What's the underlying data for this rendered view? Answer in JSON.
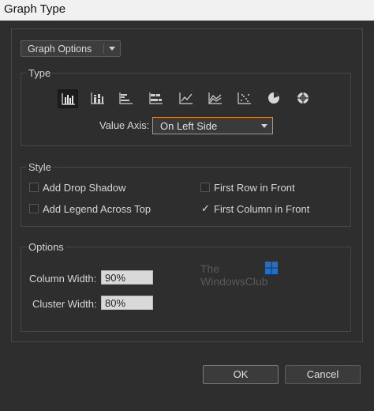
{
  "window": {
    "title": "Graph Type"
  },
  "graph_options": {
    "label": "Graph Options"
  },
  "type_group": {
    "label": "Type",
    "icons": [
      "grouped-column-graph",
      "stacked-column-graph",
      "grouped-bar-graph",
      "stacked-bar-graph",
      "line-graph",
      "area-graph",
      "scatter-graph",
      "pie-graph",
      "radar-graph"
    ],
    "selected_index": 0,
    "value_axis_label": "Value Axis:",
    "value_axis_value": "On Left Side"
  },
  "style_group": {
    "label": "Style",
    "add_drop_shadow": {
      "label": "Add Drop Shadow",
      "checked": false
    },
    "add_legend_across_top": {
      "label": "Add Legend Across Top",
      "checked": false
    },
    "first_row_in_front": {
      "label": "First Row in Front",
      "checked": false
    },
    "first_column_in_front": {
      "label": "First Column in Front",
      "checked": true,
      "mark": "✓"
    }
  },
  "options_group": {
    "label": "Options",
    "column_width_label": "Column Width:",
    "column_width_value": "90%",
    "cluster_width_label": "Cluster Width:",
    "cluster_width_value": "80%"
  },
  "watermark": {
    "line1": "The",
    "line2": "WindowsClub"
  },
  "buttons": {
    "ok": "OK",
    "cancel": "Cancel"
  },
  "colors": {
    "accent": "#e58a2a",
    "background": "#2e2e2e",
    "titlebar": "#f1f1f1",
    "watermark_blue": "#1e6fd0"
  }
}
